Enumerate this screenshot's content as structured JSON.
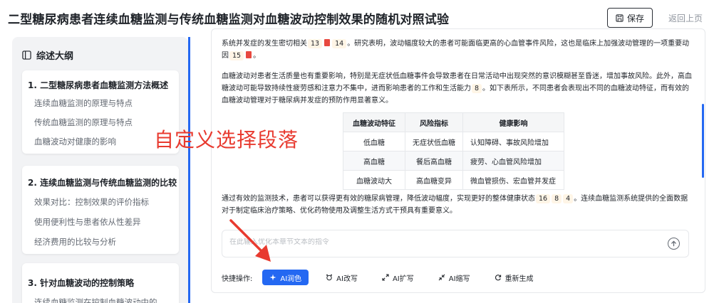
{
  "header": {
    "title": "二型糖尿病患者连续血糖监测与传统血糖监测对血糖波动控制效果的随机对照试验",
    "save_label": "保存",
    "back_label": "返回上页"
  },
  "sidebar": {
    "heading": "综述大纲",
    "sections": [
      {
        "title": "1. 二型糖尿病患者血糖监测方法概述",
        "items": [
          "连续血糖监测的原理与特点",
          "传统血糖监测的原理与特点",
          "血糖波动对健康的影响"
        ]
      },
      {
        "title": "2. 连续血糖监测与传统血糖监测的比较",
        "items": [
          "效果对比：控制效果的评价指标",
          "使用便利性与患者依从性差异",
          "经济费用的比较与分析"
        ]
      },
      {
        "title": "3. 针对血糖波动的控制策略",
        "items": [
          "连续血糖监测在控制血糖波动中的..."
        ]
      }
    ]
  },
  "article": {
    "p1": {
      "text_a": "系统并发症的发生密切相关",
      "ref_a": "13",
      "ref_b": "14",
      "text_b": "。研究表明，波动幅度较大的患者可能面临更高的心血管事件风险，这也是临床上加强波动管理的一项重要动因",
      "ref_c": "15",
      "text_c": "。"
    },
    "p2": {
      "text_a": "血糖波动对患者生活质量也有重要影响，特别是无症状低血糖事件会导致患者在日常活动中出现突然的意识模糊甚至昏迷，增加事故风险。此外，高血糖波动可能导致持续性疲劳感和注意力不集中，进而影响患者的工作和生活能力",
      "ref_a": "8",
      "text_b": "。如下表所示，不同患者会表现出不同的血糖波动特征，而有效的血糖波动管理对于糖尿病并发症的预防作用显著意义。"
    },
    "table": {
      "headers": [
        "血糖波动特征",
        "风险指标",
        "健康影响"
      ],
      "rows": [
        [
          "低血糖",
          "无症状低血糖",
          "认知障碍、事故风险增加"
        ],
        [
          "高血糖",
          "餐后高血糖",
          "疲劳、心血管风险增加"
        ],
        [
          "血糖波动大",
          "高血糖变异",
          "微血管损伤、宏血管并发症"
        ]
      ]
    },
    "p3": {
      "text_a": "通过有效的监测技术，患者可以获得更有效的糖尿病管理，降低波动幅度，实现更好的整体健康状态",
      "ref_a": "16",
      "ref_b": "8",
      "ref_c": "4",
      "text_b": "。连续血糖监测系统提供的全面数据对于制定临床治疗策略、优化药物使用及调整生活方式干预具有重要意义。"
    },
    "prompt_placeholder": "在此输入优化本章节文本的指令",
    "quick_label": "快捷操作:",
    "quick_actions": [
      "AI润色",
      "AI改写",
      "AI扩写",
      "AI缩写",
      "重新生成"
    ]
  },
  "annotation": {
    "text": "自定义选择段落",
    "color": "#e83a2f"
  },
  "colors": {
    "accent": "#2468f2",
    "ref_bg": "#fff5e6",
    "pdf_icon": "#e8483f"
  }
}
